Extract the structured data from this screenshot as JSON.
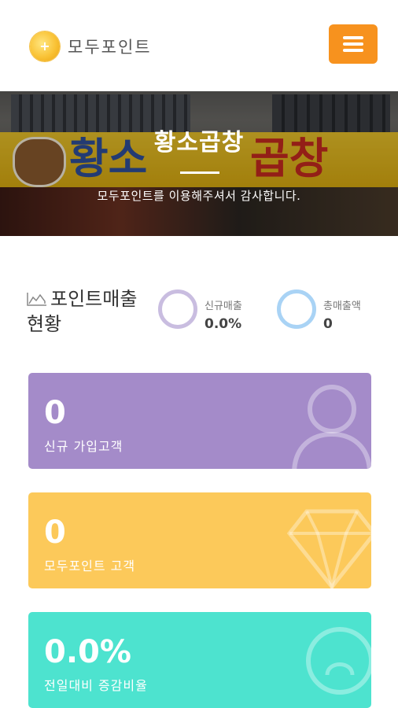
{
  "header": {
    "brand": "모두포인트",
    "logo_icon": "plus-coin-icon",
    "menu_icon": "hamburger-menu-icon",
    "menu_color": "#f7921e"
  },
  "hero": {
    "title": "황소곱창",
    "subtitle": "모두포인트를 이용해주셔서 감사합니다.",
    "sign_left": "황소",
    "sign_right": "곱창"
  },
  "overview": {
    "title": "포인트매출현황",
    "title_icon": "area-chart-icon",
    "stats": [
      {
        "label": "신규매출",
        "value": "0.0%",
        "ring_color": "#c9bde0"
      },
      {
        "label": "총매출액",
        "value": "0",
        "ring_color": "#a9d3f5"
      }
    ]
  },
  "cards": [
    {
      "value": "0",
      "label": "신규 가입고객",
      "color": "#a48bc9",
      "icon": "user-icon"
    },
    {
      "value": "0",
      "label": "모두포인트 고객",
      "color": "#fcc95a",
      "icon": "diamond-icon"
    },
    {
      "value": "0.0%",
      "label": "전일대비 증감비율",
      "color": "#4de3cf",
      "icon": "lightbulb-icon"
    }
  ]
}
